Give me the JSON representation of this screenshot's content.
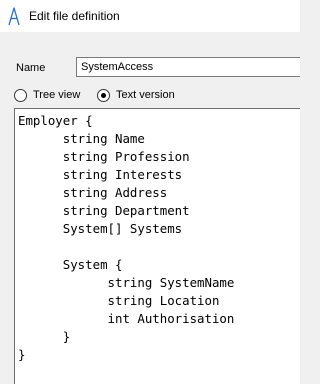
{
  "window": {
    "title": "Edit file definition",
    "icon": "a-letter-icon"
  },
  "form": {
    "name_label": "Name",
    "name_value": "SystemAccess",
    "view_mode": {
      "options": [
        {
          "label": "Tree view",
          "selected": false
        },
        {
          "label": "Text version",
          "selected": true
        }
      ]
    },
    "definition_text": "Employer {\n\tstring Name\n\tstring Profession\n\tstring Interests\n\tstring Address\n\tstring Department\n\tSystem[] Systems\n\n\tSystem {\n\t\tstring SystemName\n\t\tstring Location\n\t\tint Authorisation\n\t}\n}"
  },
  "colors": {
    "title_icon": "#1a6fd8",
    "titlebar_bg": "#ffffff",
    "dialog_bg": "#f0f0f0"
  }
}
